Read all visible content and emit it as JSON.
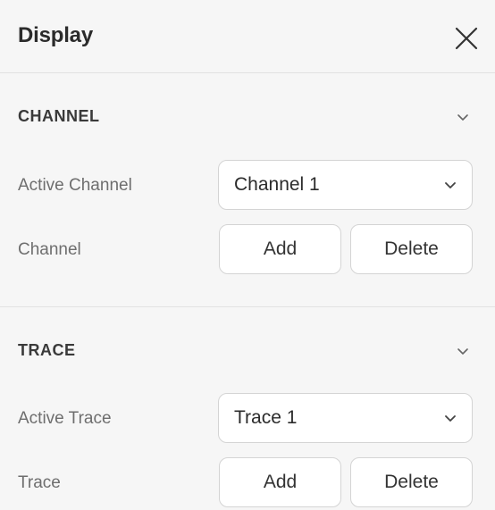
{
  "panel": {
    "title": "Display",
    "close_icon": "close-icon"
  },
  "channel_section": {
    "title": "CHANNEL",
    "collapse_icon": "chevron-down-icon",
    "active_label": "Active Channel",
    "active_value": "Channel 1",
    "row_label": "Channel",
    "add_label": "Add",
    "delete_label": "Delete"
  },
  "trace_section": {
    "title": "TRACE",
    "collapse_icon": "chevron-down-icon",
    "active_label": "Active Trace",
    "active_value": "Trace 1",
    "row_label": "Trace",
    "add_label": "Add",
    "delete_label": "Delete"
  },
  "colors": {
    "background": "#f6f6f6",
    "control_background": "#ffffff",
    "border": "#d4d4d4",
    "divider": "#e2e2e2",
    "label_text": "#6e6e6e",
    "heading_text": "#2b2b2b"
  }
}
